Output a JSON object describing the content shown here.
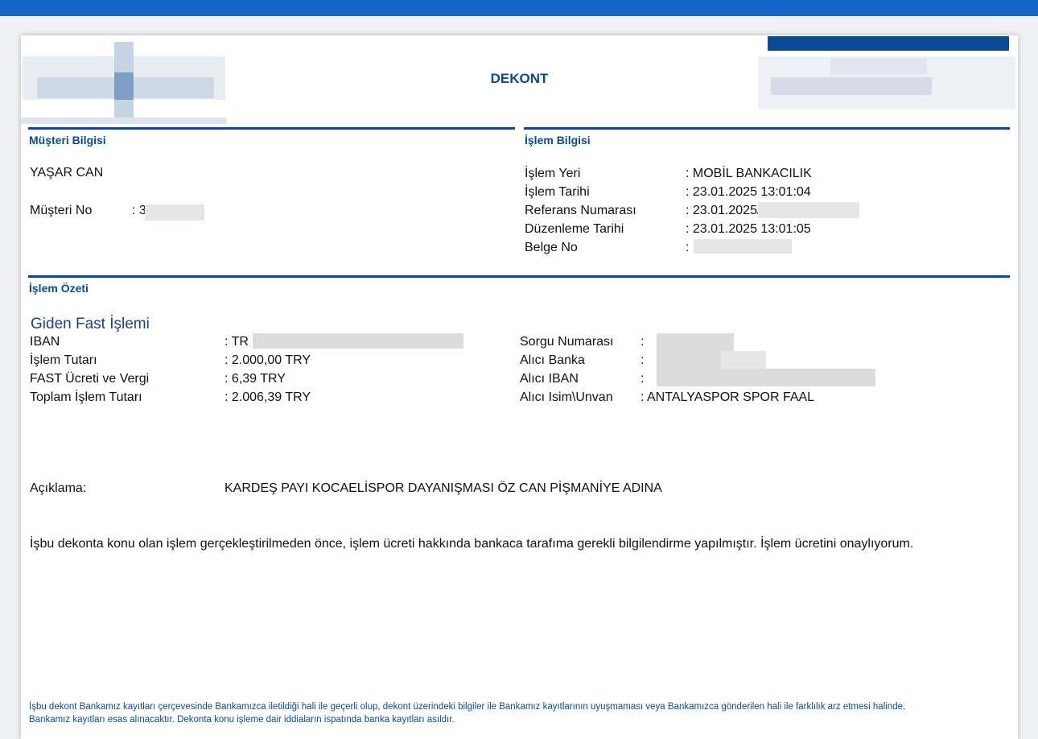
{
  "title": "DEKONT",
  "customer_section": {
    "heading": "Müşteri Bilgisi",
    "name": "YAŞAR CAN",
    "customer_no_label": "Müşteri No",
    "customer_no_value": ": 3"
  },
  "transaction_section": {
    "heading": "İşlem Bilgisi",
    "rows": [
      {
        "label": "İşlem Yeri",
        "value": ": MOBİL BANKACILIK"
      },
      {
        "label": "İşlem Tarihi",
        "value": ": 23.01.2025 13:01:04"
      },
      {
        "label": "Referans Numarası",
        "value": ": 23.01.2025/"
      },
      {
        "label": "Düzenleme Tarihi",
        "value": ": 23.01.2025  13:01:05"
      },
      {
        "label": "Belge No",
        "value": ":"
      }
    ]
  },
  "summary_section": {
    "heading": "İşlem Özeti",
    "subtitle": "Giden Fast İşlemi",
    "left_rows": [
      {
        "label": "IBAN",
        "value": ":  TR"
      },
      {
        "label": "İşlem Tutarı",
        "value": ":  2.000,00 TRY"
      },
      {
        "label": "FAST Ücreti ve Vergi",
        "value": ":  6,39 TRY"
      },
      {
        "label": "Toplam İşlem Tutarı",
        "value": ":  2.006,39 TRY"
      }
    ],
    "right_rows": [
      {
        "label": "Sorgu Numarası",
        "value": ":"
      },
      {
        "label": "Alıcı Banka",
        "value": ":"
      },
      {
        "label": "Alıcı IBAN",
        "value": ":"
      },
      {
        "label": "Alıcı Isim\\Unvan",
        "value": ":  ANTALYASPOR SPOR FAAL"
      }
    ]
  },
  "description": {
    "label": "Açıklama:",
    "value": "KARDEŞ PAYI KOCAELİSPOR DAYANIŞMASI ÖZ CAN PİŞMANİYE ADINA"
  },
  "consent_text": "İşbu dekonta konu olan işlem gerçekleştirilmeden önce, işlem ücreti hakkında bankaca tarafıma gerekli bilgilendirme yapılmıştır. İşlem ücretini onaylıyorum.",
  "footer": {
    "line1": "İşbu dekont Bankamız kayıtları çerçevesinde Bankamızca iletildiği hali ile geçerli olup, dekont üzerindeki bilgiler ile Bankamız kayıtlarının uyuşmaması veya Bankamızca gönderilen hali ile farklılık arz etmesi halinde,",
    "line2": "Bankamız kayıtları esas alınacaktır. Dekonta konu işleme dair iddiaların ispatında banka kayıtları asıldır."
  }
}
